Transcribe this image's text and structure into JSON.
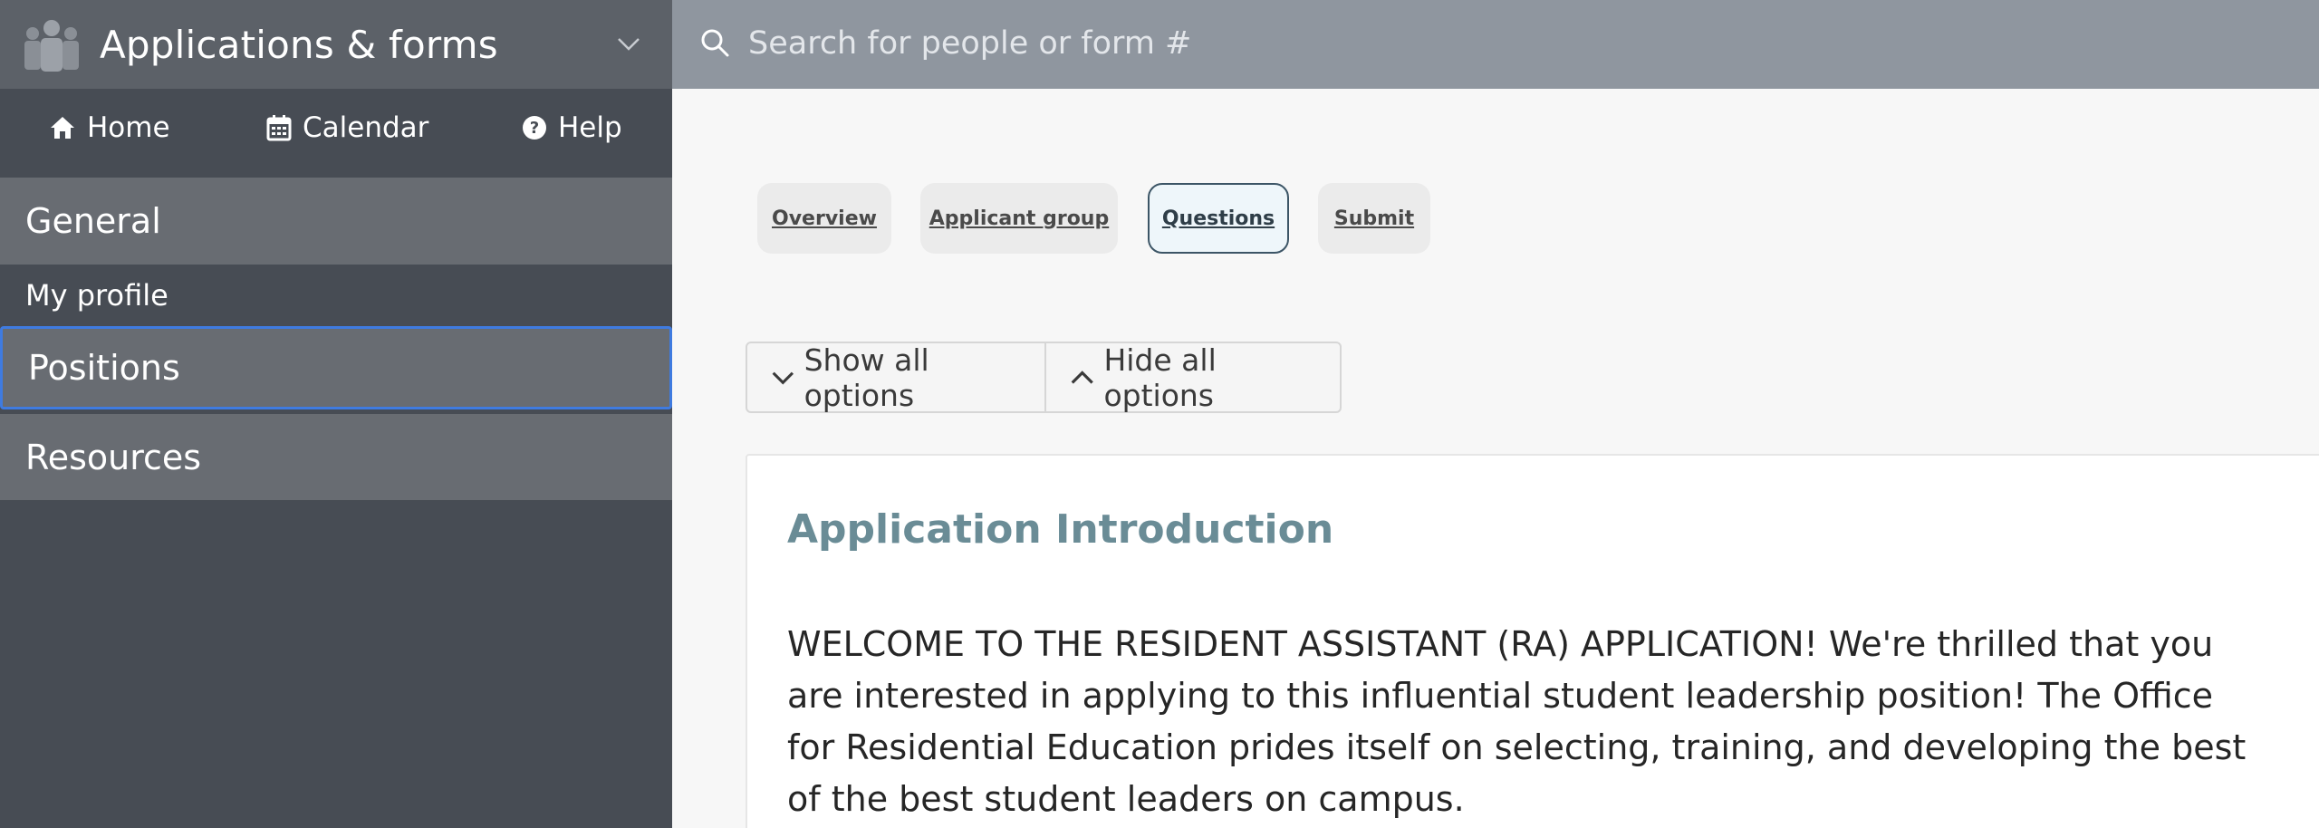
{
  "app": {
    "title": "Applications & forms"
  },
  "nav": {
    "home": "Home",
    "calendar": "Calendar",
    "help": "Help"
  },
  "sidebar": {
    "sections": [
      {
        "label": "General"
      },
      {
        "label": "My profile"
      },
      {
        "label": "Positions"
      },
      {
        "label": "Resources"
      }
    ]
  },
  "search": {
    "placeholder": "Search for people or form #"
  },
  "tabs": [
    {
      "label": "Overview"
    },
    {
      "label": "Applicant group"
    },
    {
      "label": "Questions",
      "active": true
    },
    {
      "label": "Submit"
    }
  ],
  "options": {
    "show_all": "Show all options",
    "hide_all": "Hide all options"
  },
  "card": {
    "title": "Application Introduction",
    "body": "WELCOME TO THE RESIDENT ASSISTANT (RA) APPLICATION! We're thrilled that you are interested in applying to this influential student leadership position! The Office for Residential Education prides itself on selecting, training, and developing the best of the best student leaders on campus."
  },
  "colors": {
    "sidebar_bg": "#474c54",
    "sidebar_section": "#686c72",
    "search_bar": "#8f969f",
    "accent_focus": "#3f7be0",
    "card_title": "#6a8c96"
  }
}
